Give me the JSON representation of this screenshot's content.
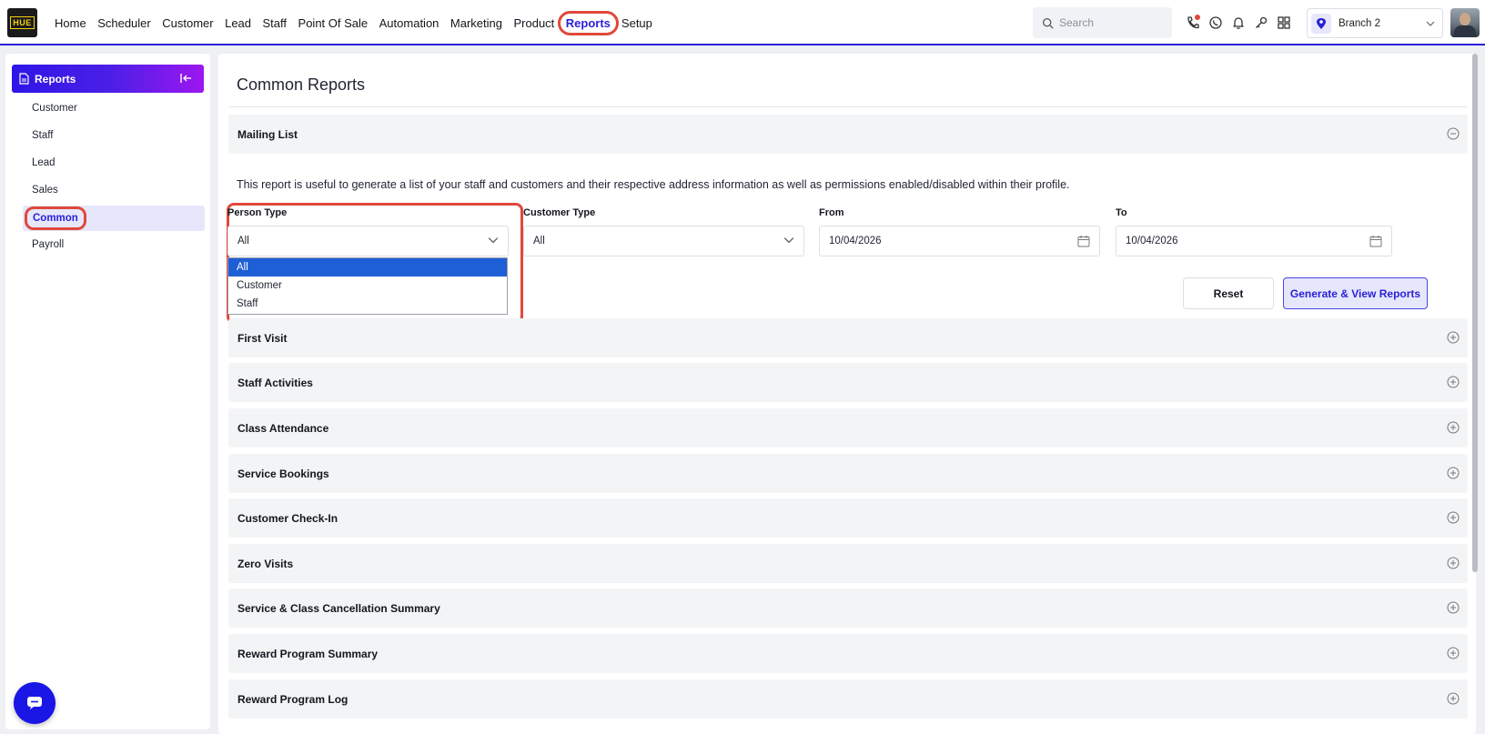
{
  "app": {
    "logo_text": "HUE"
  },
  "nav": {
    "items": [
      "Home",
      "Scheduler",
      "Customer",
      "Lead",
      "Staff",
      "Point Of Sale",
      "Automation",
      "Marketing",
      "Product",
      "Reports",
      "Setup"
    ],
    "active": "Reports"
  },
  "search": {
    "placeholder": "Search"
  },
  "branch": {
    "selected": "Branch 2"
  },
  "sidebar": {
    "title": "Reports",
    "items": [
      {
        "label": "Customer"
      },
      {
        "label": "Staff"
      },
      {
        "label": "Lead"
      },
      {
        "label": "Sales"
      },
      {
        "label": "Common",
        "active": true
      },
      {
        "label": "Payroll"
      }
    ]
  },
  "main": {
    "title": "Common Reports",
    "open_section": {
      "title": "Mailing List",
      "description": "This report is useful to generate a list of your staff and customers and their respective address information as well as permissions enabled/disabled within their profile.",
      "person_type": {
        "label": "Person Type",
        "value": "All",
        "options": [
          "All",
          "Customer",
          "Staff"
        ]
      },
      "customer_type": {
        "label": "Customer Type",
        "value": "All"
      },
      "from": {
        "label": "From",
        "value": "10/04/2026"
      },
      "to": {
        "label": "To",
        "value": "10/04/2026"
      },
      "reset_label": "Reset",
      "generate_label": "Generate & View Reports"
    },
    "sections": [
      "First Visit",
      "Staff Activities",
      "Class Attendance",
      "Service Bookings",
      "Customer Check-In",
      "Zero Visits",
      "Service & Class Cancellation Summary",
      "Reward Program Summary",
      "Reward Program Log"
    ]
  },
  "colors": {
    "accent": "#2a1fd6",
    "highlight": "#e0483b",
    "dropdown_selected": "#1f5fd6"
  }
}
